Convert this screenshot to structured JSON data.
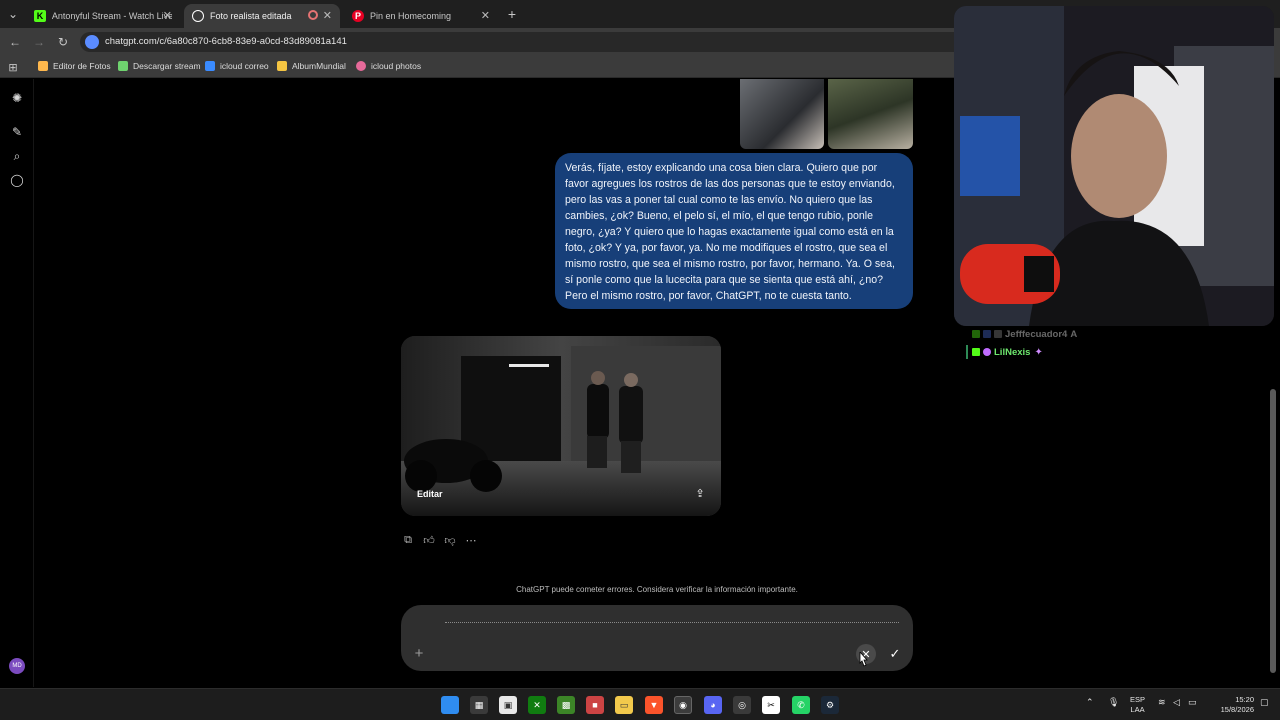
{
  "tabs": [
    {
      "title": "Antonyful Stream - Watch Live",
      "favicon": "kick-icon",
      "color": "#53fc18"
    },
    {
      "title": "Foto realista editada",
      "favicon": "chatgpt-icon",
      "color": "#ffffff"
    },
    {
      "title": "Pin en Homecoming",
      "favicon": "pinterest-icon",
      "color": "#e60023"
    }
  ],
  "address_bar": {
    "url": "chatgpt.com/c/6a80c870-6cb8-83e9-a0cd-83d89081a141"
  },
  "bookmarks": [
    {
      "label": "Editor de Fotos",
      "color": "#ffb84d"
    },
    {
      "label": "Descargar stream",
      "color": "#6fd36f"
    },
    {
      "label": "icloud correo",
      "color": "#3a8bff"
    },
    {
      "label": "AlbumMundial",
      "color": "#f5c542"
    },
    {
      "label": "icloud photos",
      "color": "#e76a9a"
    }
  ],
  "user_message": "Verás, fíjate, estoy explicando una cosa bien clara. Quiero que por favor agregues los rostros de las dos personas que te estoy enviando, pero las vas a poner tal cual como te las envío. No quiero que las cambies, ¿ok? Bueno, el pelo sí, el mío, el que tengo rubio, ponle negro, ¿ya? Y quiero que lo hagas exactamente igual como está en la foto, ¿ok? Y ya, por favor, ya. No me modifiques el rostro, que sea el mismo rostro, que sea el mismo rostro, por favor, hermano. Ya. O sea, sí ponle como que la lucecita para que se sienta que está ahí, ¿no? Pero el mismo rostro, por favor, ChatGPT, no te cuesta tanto.",
  "generated_image": {
    "edit_label": "Editar"
  },
  "disclaimer": "ChatGPT puede cometer errores. Considera verificar la información importante.",
  "avatar_initials": "MD",
  "chat_overlay": [
    {
      "username": "Jefffecuador4",
      "suffix": "A",
      "color": "#ffffff",
      "faded": true
    },
    {
      "username": "LilNexis",
      "suffix": "",
      "color": "#6ee86e",
      "faded": false
    }
  ],
  "system_tray": {
    "lang_line1": "ESP",
    "lang_line2": "LAA",
    "time": "15:20",
    "date": "15/8/2026"
  }
}
